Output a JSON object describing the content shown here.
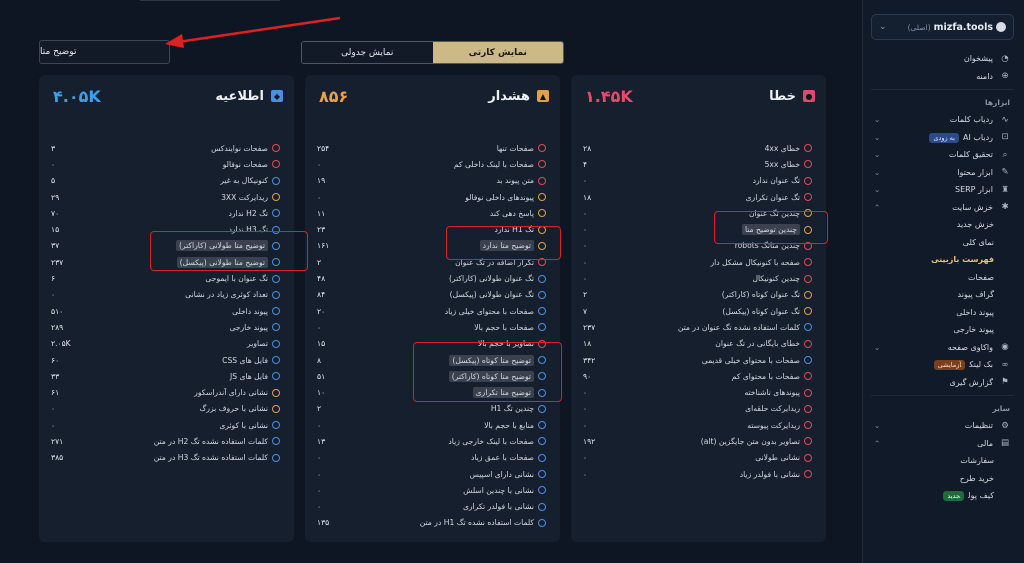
{
  "top": {
    "meta_button": "توضیح متا",
    "view_toggle": [
      "نمایش کارتی",
      "نمایش جدولی"
    ]
  },
  "sidebar": {
    "site": {
      "name": "mizfa.tools",
      "tag": "(اصلی)"
    },
    "top_items": [
      {
        "label": "پیشخوان",
        "icon": "pie-chart-icon"
      },
      {
        "label": "دامنه",
        "icon": "globe-icon"
      }
    ],
    "tools_title": "ابزارها",
    "tools": [
      {
        "label": "ردیاب کلمات",
        "icon": "chart-icon",
        "chevron": true
      },
      {
        "label": "ردیاب AI",
        "icon": "robot-icon",
        "badge": "به زودی",
        "badge_color": "blue",
        "chevron": true
      },
      {
        "label": "تحقیق کلمات",
        "icon": "search-icon",
        "chevron": true
      },
      {
        "label": "ابزار محتوا",
        "icon": "pen-icon",
        "chevron": true
      },
      {
        "label": "ابزار SERP",
        "icon": "trophy-icon",
        "chevron": true
      },
      {
        "label": "خزش سایت",
        "icon": "bug-icon",
        "chevron": true,
        "open": true
      }
    ],
    "crawl_sub": [
      "خزش جدید",
      "نمای کلی",
      "فهرست بازبینی",
      "صفحات",
      "گراف پیوند",
      "پیوند داخلی",
      "پیوند خارجی"
    ],
    "more_tools": [
      {
        "label": "واکاوی صفحه",
        "icon": "gauge-icon",
        "chevron": true
      },
      {
        "label": "بک لینک",
        "icon": "link-icon",
        "badge": "آزمایشی",
        "badge_color": "orange",
        "chevron": false
      },
      {
        "label": "گزارش گیری",
        "icon": "flag-icon",
        "chevron": false
      }
    ],
    "other_title": "سایر",
    "other": [
      {
        "label": "تنظیمات",
        "icon": "gear-icon",
        "chevron": true
      },
      {
        "label": "مالی",
        "icon": "wallet-icon",
        "chevron": true,
        "open": true
      }
    ],
    "finance_sub": [
      "سفارشات",
      "خرید طرح"
    ],
    "wallet": {
      "label": "کیف پول",
      "badge": "جدید"
    }
  },
  "cards": {
    "error": {
      "title": "خطا",
      "total": "۱.۴۵K",
      "color": "#e84a6a",
      "rows": [
        {
          "label": "خطای 4xx",
          "count": "۲۸",
          "status": "red"
        },
        {
          "label": "خطای 5xx",
          "count": "۴",
          "status": "red"
        },
        {
          "label": "تگ عنوان ندارد",
          "count": "۰",
          "status": "red"
        },
        {
          "label": "تگ عنوان تکراری",
          "count": "۱۸",
          "status": "red"
        },
        {
          "label": "چندین تگ عنوان",
          "count": "۰",
          "status": "orange"
        },
        {
          "label": "چندین توضیح متا",
          "count": "۰",
          "status": "orange"
        },
        {
          "label": "چندین متاتگ robots",
          "count": "۰",
          "status": "red"
        },
        {
          "label": "صفحه با کنونیکال مشکل دار",
          "count": "۰",
          "status": "red"
        },
        {
          "label": "چندین کنونیکال",
          "count": "۰",
          "status": "red"
        },
        {
          "label": "تگ عنوان کوتاه (کاراکتر)",
          "count": "۲",
          "status": "orange"
        },
        {
          "label": "تگ عنوان کوتاه (پیکسل)",
          "count": "۷",
          "status": "orange"
        },
        {
          "label": "کلمات استفاده نشده تگ عنوان در متن",
          "count": "۲۳۷",
          "status": "blue"
        },
        {
          "label": "خطای بایگانی در تگ عنوان",
          "count": "۱۸",
          "status": "red"
        },
        {
          "label": "صفحات با محتوای خیلی قدیمی",
          "count": "۳۴۲",
          "status": "blue"
        },
        {
          "label": "صفحات با محتوای کم",
          "count": "۹۰",
          "status": "red"
        },
        {
          "label": "پیوندهای ناشناخته",
          "count": "۰",
          "status": "red"
        },
        {
          "label": "ریدایرکت حلقه‌ای",
          "count": "۰",
          "status": "red"
        },
        {
          "label": "ریدایرکت پیوسته",
          "count": "۰",
          "status": "red"
        },
        {
          "label": "تصاویر بدون متن جایگزین (alt)",
          "count": "۱۹۲",
          "status": "red"
        },
        {
          "label": "نشانی طولانی",
          "count": "۰",
          "status": "red"
        },
        {
          "label": "نشانی با فولدر زیاد",
          "count": "۰",
          "status": "red"
        }
      ]
    },
    "warning": {
      "title": "هشدار",
      "total": "۸۵۶",
      "color": "#e8a04a",
      "rows": [
        {
          "label": "صفحات تنها",
          "count": "۲۵۴",
          "status": "red"
        },
        {
          "label": "صفحات با لینک داخلی کم",
          "count": "۰",
          "status": "red"
        },
        {
          "label": "متن پیوند بد",
          "count": "۱۹",
          "status": "red"
        },
        {
          "label": "پیوندهای داخلی نوفالو",
          "count": "۰",
          "status": "orange"
        },
        {
          "label": "پاسخ دهی کند",
          "count": "۱۱",
          "status": "orange"
        },
        {
          "label": "تگ H1 ندارد",
          "count": "۲۳",
          "status": "orange"
        },
        {
          "label": "توضیح متا ندارد",
          "count": "۱۶۱",
          "status": "orange"
        },
        {
          "label": "تکرار اضافه در تگ عنوان",
          "count": "۲",
          "status": "red"
        },
        {
          "label": "تگ عنوان طولانی (کاراکتر)",
          "count": "۴۸",
          "status": "blue"
        },
        {
          "label": "تگ عنوان طولانی (پیکسل)",
          "count": "۸۴",
          "status": "blue"
        },
        {
          "label": "صفحات با محتوای خیلی زیاد",
          "count": "۲۰",
          "status": "blue"
        },
        {
          "label": "صفحات با حجم بالا",
          "count": "۰",
          "status": "blue"
        },
        {
          "label": "تصاویر با حجم بالا",
          "count": "۱۵",
          "status": "red"
        },
        {
          "label": "توضیح متا کوتاه (پیکسل)",
          "count": "۸",
          "status": "blue"
        },
        {
          "label": "توضیح متا کوتاه (کاراکتر)",
          "count": "۵۱",
          "status": "blue"
        },
        {
          "label": "توضیح متا تکراری",
          "count": "۱۰",
          "status": "blue"
        },
        {
          "label": "چندین تگ H1",
          "count": "۲",
          "status": "blue"
        },
        {
          "label": "منابع با حجم بالا",
          "count": "۰",
          "status": "blue"
        },
        {
          "label": "صفحات با لینک خارجی زیاد",
          "count": "۱۳",
          "status": "blue"
        },
        {
          "label": "صفحات با عمق زیاد",
          "count": "۰",
          "status": "blue"
        },
        {
          "label": "نشانی دارای اسپیس",
          "count": "۰",
          "status": "blue"
        },
        {
          "label": "نشانی با چندین اسلش",
          "count": "۰",
          "status": "blue"
        },
        {
          "label": "نشانی با فولدر تکراری",
          "count": "۰",
          "status": "blue"
        },
        {
          "label": "کلمات استفاده نشده تگ H1 در متن",
          "count": "۱۳۵",
          "status": "blue"
        }
      ]
    },
    "info": {
      "title": "اطلاعیه",
      "total": "۴.۰۵K",
      "color": "#3aa0f0",
      "rows": [
        {
          "label": "صفحات نوایندکس",
          "count": "۳",
          "status": "red"
        },
        {
          "label": "صفحات نوفالو",
          "count": "۰",
          "status": "red"
        },
        {
          "label": "کنونیکال به غیر",
          "count": "۵",
          "status": "blue"
        },
        {
          "label": "ریدایرکت 3XX",
          "count": "۲۹",
          "status": "orange"
        },
        {
          "label": "تگ H2 ندارد",
          "count": "۷۰",
          "status": "blue"
        },
        {
          "label": "تگ H3 ندارد",
          "count": "۱۵",
          "status": "blue"
        },
        {
          "label": "توضیح متا طولانی (کاراکتر)",
          "count": "۳۷",
          "status": "blue"
        },
        {
          "label": "توضیح متا طولانی (پیکسل)",
          "count": "۲۳۷",
          "status": "blue"
        },
        {
          "label": "تگ عنوان با ایموجی",
          "count": "۶",
          "status": "blue"
        },
        {
          "label": "تعداد کوئری زیاد در نشانی",
          "count": "۰",
          "status": "blue"
        },
        {
          "label": "پیوند داخلی",
          "count": "۵۱۰",
          "status": "blue"
        },
        {
          "label": "پیوند خارجی",
          "count": "۲۸۹",
          "status": "blue"
        },
        {
          "label": "تصاویر",
          "count": "۲.۰۵K",
          "status": "blue"
        },
        {
          "label": "فایل های CSS",
          "count": "۶۰",
          "status": "blue"
        },
        {
          "label": "فایل های JS",
          "count": "۳۳",
          "status": "blue"
        },
        {
          "label": "نشانی دارای آندراسکور",
          "count": "۶۱",
          "status": "orange"
        },
        {
          "label": "نشانی با حروف بزرگ",
          "count": "۰",
          "status": "orange"
        },
        {
          "label": "نشانی با کوئری",
          "count": "۰",
          "status": "blue"
        },
        {
          "label": "کلمات استفاده نشده تگ H2 در متن",
          "count": "۲۷۱",
          "status": "blue"
        },
        {
          "label": "کلمات استفاده نشده تگ H3 در متن",
          "count": "۳۸۵",
          "status": "blue"
        }
      ]
    }
  }
}
